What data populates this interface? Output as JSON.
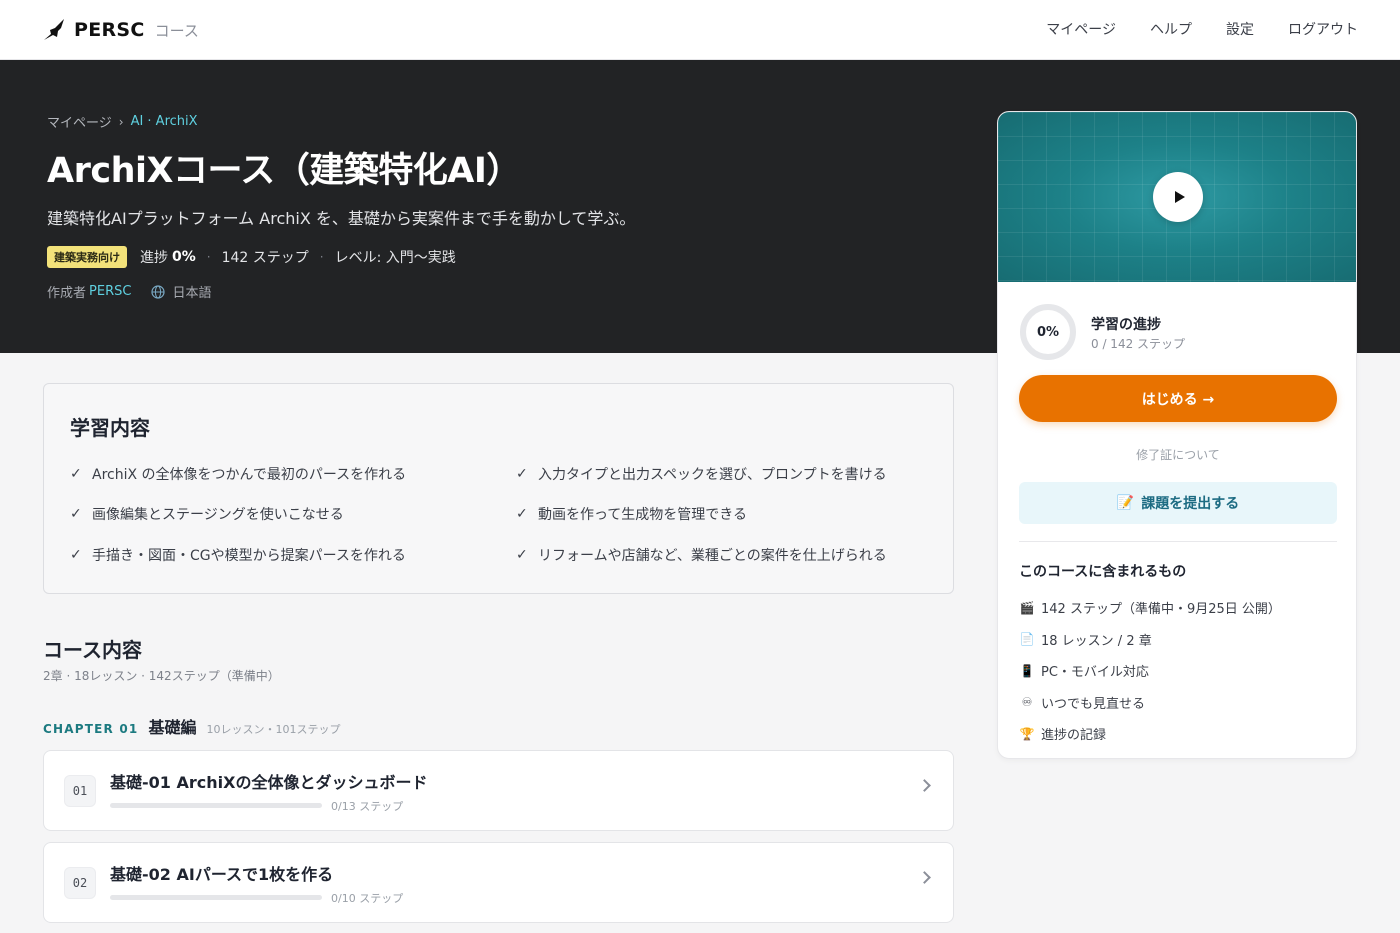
{
  "nav": {
    "brand": "PERSC",
    "brand_sub": "コース",
    "links": [
      "マイページ",
      "ヘルプ",
      "設定",
      "ログアウト"
    ]
  },
  "hero": {
    "breadcrumb": {
      "home": "マイページ",
      "sep": "›",
      "current": "AI · ArchiX"
    },
    "title": "ArchiXコース（建築特化AI）",
    "description": "建築特化AIプラットフォーム ArchiX を、基礎から実案件まで手を動かして学ぶ。",
    "badge": "建築実務向け",
    "progress_label": "進捗",
    "progress_value": "0%",
    "steps": "142 ステップ",
    "level": "レベル: 入門〜実践",
    "meta_sep": "·",
    "author_label": "作成者",
    "author": "PERSC",
    "language": "日本語"
  },
  "sidecard": {
    "progress_percent": "0%",
    "progress_fraction": 0,
    "progress_title": "学習の進捗",
    "progress_sub": "0 / 142 ステップ",
    "start_label": "はじめる →",
    "cert_label": "修了証について",
    "submit_icon": "📝",
    "submit_label": "課題を提出する",
    "includes_title": "このコースに含まれるもの",
    "includes": [
      {
        "icon": "🎬",
        "icon_name": "clapper-icon",
        "text": "142 ステップ（準備中・9月25日 公開）"
      },
      {
        "icon": "📄",
        "icon_name": "document-icon",
        "text": "18 レッスン / 2 章"
      },
      {
        "icon": "📱",
        "icon_name": "mobile-icon",
        "text": "PC・モバイル対応"
      },
      {
        "icon": "♾",
        "icon_name": "infinity-icon",
        "text": "いつでも見直せる"
      },
      {
        "icon": "🏆",
        "icon_name": "trophy-icon",
        "text": "進捗の記録"
      }
    ]
  },
  "learn": {
    "title": "学習内容",
    "check": "✓",
    "items": [
      "ArchiX の全体像をつかんで最初のパースを作れる",
      "入力タイプと出力スペックを選び、プロンプトを書ける",
      "画像編集とステージングを使いこなせる",
      "動画を作って生成物を管理できる",
      "手描き・図面・CGや模型から提案パースを作れる",
      "リフォームや店舗など、業種ごとの案件を仕上げられる"
    ]
  },
  "course_content": {
    "title": "コース内容",
    "sub": "2章 · 18レッスン · 142ステップ（準備中）",
    "chapter": {
      "label": "CHAPTER 01",
      "name": "基礎編",
      "meta": "10レッスン・101ステップ"
    },
    "lessons": [
      {
        "num": "01",
        "title": "基礎-01 ArchiXの全体像とダッシュボード",
        "steps": "0/13 ステップ",
        "progress": 0
      },
      {
        "num": "02",
        "title": "基礎-02 AIパースで1枚を作る",
        "steps": "0/10 ステップ",
        "progress": 0
      }
    ]
  },
  "colors": {
    "accent": "#e87200",
    "teal": "#1c7a80",
    "hero_bg": "#222325"
  }
}
